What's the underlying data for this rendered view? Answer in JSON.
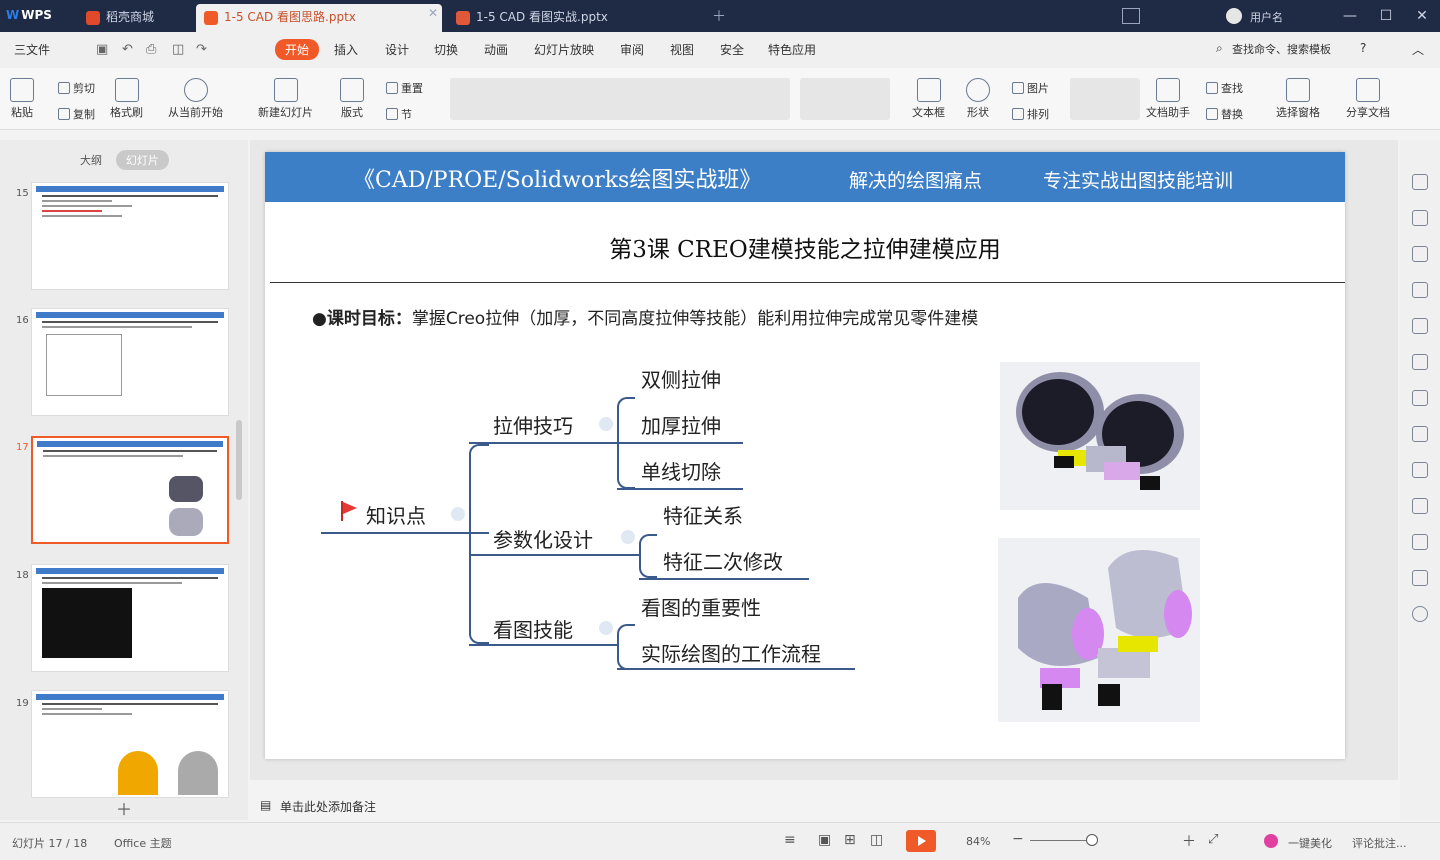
{
  "app": {
    "brand": "WPS"
  },
  "tabs": [
    {
      "label": "稻壳商城"
    },
    {
      "label": "1-5 CAD 看图思路.pptx"
    },
    {
      "label": "1-5 CAD 看图实战.pptx"
    }
  ],
  "account": {
    "name": "用户名"
  },
  "menu": {
    "file": "三文件",
    "items": [
      "开始",
      "插入",
      "设计",
      "切换",
      "动画",
      "幻灯片放映",
      "审阅",
      "视图",
      "安全",
      "特色应用"
    ],
    "search": "查找命令、搜索模板"
  },
  "ribbon": {
    "paste": "粘贴",
    "cut": "剪切",
    "copy": "复制",
    "format_painter": "格式刷",
    "from_current": "从当前开始",
    "new_slide": "新建幻灯片",
    "layout": "版式",
    "reset": "重置",
    "section": "节",
    "textbox": "文本框",
    "shape": "形状",
    "picture": "图片",
    "arrange": "排列",
    "find": "查找",
    "replace": "替换",
    "doc_assistant": "文档助手",
    "select_pane": "选择窗格",
    "share": "分享文档"
  },
  "left_panel": {
    "tab_outline": "大纲",
    "tab_slides": "幻灯片",
    "thumb_numbers": [
      "15",
      "16",
      "17",
      "18",
      "19"
    ]
  },
  "slide": {
    "header_title": "《CAD/PROE/Solidworks绘图实战班》",
    "header_tag1": "解决的绘图痛点",
    "header_tag2": "专注实战出图技能培训",
    "title": "第3课  CREO建模技能之拉伸建模应用",
    "goal_label": "●课时目标：",
    "goal_text": "掌握Creo拉伸（加厚，不同高度拉伸等技能）能利用拉伸完成常见零件建模",
    "mindmap": {
      "root": "知识点",
      "branch1": "拉伸技巧",
      "b1_items": [
        "双侧拉伸",
        "加厚拉伸",
        "单线切除"
      ],
      "branch2": "参数化设计",
      "b2_items": [
        "特征关系",
        "特征二次修改"
      ],
      "branch3": "看图技能",
      "b3_items": [
        "看图的重要性",
        "实际绘图的工作流程"
      ]
    }
  },
  "notes": {
    "placeholder": "单击此处添加备注"
  },
  "status": {
    "slide_counter": "幻灯片 17 / 18",
    "theme": "Office 主题",
    "zoom": "84%",
    "beautify": "一键美化",
    "comments": "评论批注..."
  },
  "colors": {
    "accent": "#f05a28",
    "header_blue": "#3d7fc6",
    "tabbar": "#1f2a44"
  }
}
